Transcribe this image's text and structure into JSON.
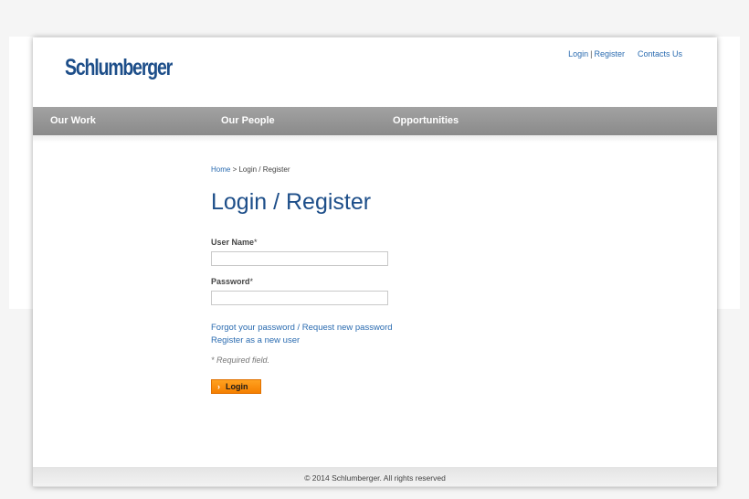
{
  "header": {
    "logo_text": "Schlumberger",
    "links": {
      "login": "Login",
      "separator": "|",
      "register": "Register",
      "contacts": "Contacts Us"
    }
  },
  "nav": {
    "items": [
      {
        "label": "Our Work"
      },
      {
        "label": "Our People"
      },
      {
        "label": "Opportunities"
      }
    ]
  },
  "breadcrumb": {
    "home": "Home",
    "separator": " > ",
    "current": "Login / Register"
  },
  "main": {
    "title": "Login / Register",
    "username": {
      "label": "User Name",
      "required_mark": "*",
      "value": ""
    },
    "password": {
      "label": "Password",
      "required_mark": "*",
      "value": ""
    },
    "forgot_link": "Forgot your password / Request new password",
    "register_link": "Register as a new user",
    "required_note": "* Required field.",
    "login_button": {
      "icon": "chevron-right-icon",
      "label": "Login"
    }
  },
  "footer": {
    "copyright": "© 2014 Schlumberger. All rights reserved"
  },
  "colors": {
    "brand_blue": "#1d4e89",
    "link_blue": "#2a6bb0",
    "nav_gray": "#999999",
    "button_orange": "#f58a0a"
  }
}
